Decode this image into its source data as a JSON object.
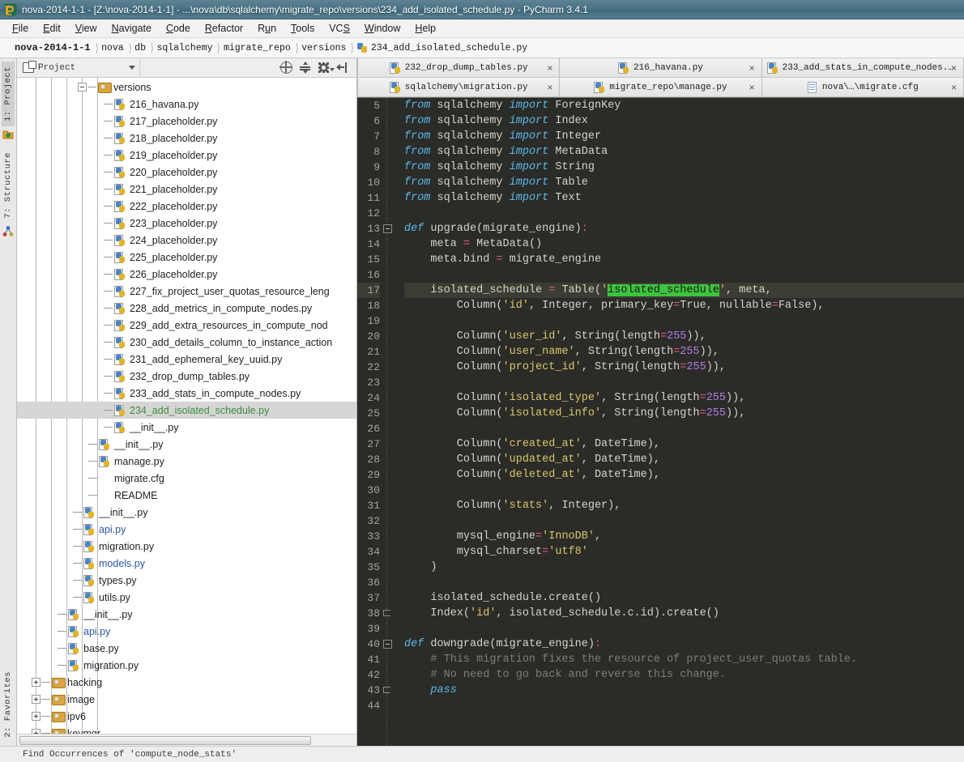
{
  "window": {
    "title": "nova-2014-1-1 - [Z:\\nova-2014-1-1] - ...\\nova\\db\\sqlalchemy\\migrate_repo\\versions\\234_add_isolated_schedule.py - PyCharm 3.4.1",
    "app_icon": "pycharm-icon"
  },
  "menubar": {
    "items": [
      {
        "label": "File",
        "mnemonic": "F"
      },
      {
        "label": "Edit",
        "mnemonic": "E"
      },
      {
        "label": "View",
        "mnemonic": "V"
      },
      {
        "label": "Navigate",
        "mnemonic": "N"
      },
      {
        "label": "Code",
        "mnemonic": "C"
      },
      {
        "label": "Refactor",
        "mnemonic": "R"
      },
      {
        "label": "Run",
        "mnemonic": "n"
      },
      {
        "label": "Tools",
        "mnemonic": "T"
      },
      {
        "label": "VCS",
        "mnemonic": "S"
      },
      {
        "label": "Window",
        "mnemonic": "W"
      },
      {
        "label": "Help",
        "mnemonic": "H"
      }
    ]
  },
  "breadcrumb": {
    "items": [
      "nova-2014-1-1",
      "nova",
      "db",
      "sqlalchemy",
      "migrate_repo",
      "versions"
    ],
    "file": "234_add_isolated_schedule.py"
  },
  "left_tool_strip": {
    "top": [
      {
        "label": "1: Project",
        "selected": true,
        "icon": "project-icon"
      },
      {
        "label": "7: Structure",
        "selected": false,
        "icon": "structure-icon"
      }
    ],
    "bottom": [
      {
        "label": "2: Favorites",
        "selected": false
      }
    ]
  },
  "project_panel": {
    "title": "Project",
    "tools": [
      "scroll-from-source-icon",
      "collapse-all-icon",
      "settings-gear-icon",
      "hide-icon"
    ],
    "tree": [
      {
        "depth": 6,
        "label": "versions",
        "type": "folder",
        "handle": "minus",
        "color": "default"
      },
      {
        "depth": 7,
        "label": "216_havana.py",
        "type": "py",
        "color": "default"
      },
      {
        "depth": 7,
        "label": "217_placeholder.py",
        "type": "py",
        "color": "default"
      },
      {
        "depth": 7,
        "label": "218_placeholder.py",
        "type": "py",
        "color": "default"
      },
      {
        "depth": 7,
        "label": "219_placeholder.py",
        "type": "py",
        "color": "default"
      },
      {
        "depth": 7,
        "label": "220_placeholder.py",
        "type": "py",
        "color": "default"
      },
      {
        "depth": 7,
        "label": "221_placeholder.py",
        "type": "py",
        "color": "default"
      },
      {
        "depth": 7,
        "label": "222_placeholder.py",
        "type": "py",
        "color": "default"
      },
      {
        "depth": 7,
        "label": "223_placeholder.py",
        "type": "py",
        "color": "default"
      },
      {
        "depth": 7,
        "label": "224_placeholder.py",
        "type": "py",
        "color": "default"
      },
      {
        "depth": 7,
        "label": "225_placeholder.py",
        "type": "py",
        "color": "default"
      },
      {
        "depth": 7,
        "label": "226_placeholder.py",
        "type": "py",
        "color": "default"
      },
      {
        "depth": 7,
        "label": "227_fix_project_user_quotas_resource_leng",
        "type": "py",
        "color": "default"
      },
      {
        "depth": 7,
        "label": "228_add_metrics_in_compute_nodes.py",
        "type": "py",
        "color": "default"
      },
      {
        "depth": 7,
        "label": "229_add_extra_resources_in_compute_nod",
        "type": "py",
        "color": "default"
      },
      {
        "depth": 7,
        "label": "230_add_details_column_to_instance_action",
        "type": "py",
        "color": "default"
      },
      {
        "depth": 7,
        "label": "231_add_ephemeral_key_uuid.py",
        "type": "py",
        "color": "default"
      },
      {
        "depth": 7,
        "label": "232_drop_dump_tables.py",
        "type": "py",
        "color": "default"
      },
      {
        "depth": 7,
        "label": "233_add_stats_in_compute_nodes.py",
        "type": "py",
        "color": "default"
      },
      {
        "depth": 7,
        "label": "234_add_isolated_schedule.py",
        "type": "py",
        "color": "green",
        "selected": true
      },
      {
        "depth": 7,
        "label": "__init__.py",
        "type": "py",
        "color": "default",
        "last": true
      },
      {
        "depth": 6,
        "label": "__init__.py",
        "type": "py",
        "color": "default"
      },
      {
        "depth": 6,
        "label": "manage.py",
        "type": "py",
        "color": "default"
      },
      {
        "depth": 6,
        "label": "migrate.cfg",
        "type": "none",
        "color": "default"
      },
      {
        "depth": 6,
        "label": "README",
        "type": "none",
        "color": "default",
        "last": true
      },
      {
        "depth": 5,
        "label": "__init__.py",
        "type": "py",
        "color": "default"
      },
      {
        "depth": 5,
        "label": "api.py",
        "type": "py",
        "color": "blue"
      },
      {
        "depth": 5,
        "label": "migration.py",
        "type": "py",
        "color": "default"
      },
      {
        "depth": 5,
        "label": "models.py",
        "type": "py",
        "color": "blue"
      },
      {
        "depth": 5,
        "label": "types.py",
        "type": "py",
        "color": "default"
      },
      {
        "depth": 5,
        "label": "utils.py",
        "type": "py",
        "color": "default",
        "last": true
      },
      {
        "depth": 4,
        "label": "__init__.py",
        "type": "py",
        "color": "default"
      },
      {
        "depth": 4,
        "label": "api.py",
        "type": "py",
        "color": "blue"
      },
      {
        "depth": 4,
        "label": "base.py",
        "type": "py",
        "color": "default"
      },
      {
        "depth": 4,
        "label": "migration.py",
        "type": "py",
        "color": "default",
        "last": true
      },
      {
        "depth": 3,
        "label": "hacking",
        "type": "folder",
        "handle": "plus",
        "color": "default"
      },
      {
        "depth": 3,
        "label": "image",
        "type": "folder",
        "handle": "plus",
        "color": "default"
      },
      {
        "depth": 3,
        "label": "ipv6",
        "type": "folder",
        "handle": "plus",
        "color": "default"
      },
      {
        "depth": 3,
        "label": "keymgr",
        "type": "folder",
        "handle": "plus",
        "color": "default"
      }
    ]
  },
  "editor_tabs": {
    "row1": [
      {
        "label": "232_drop_dump_tables.py",
        "icon": "py-file-icon",
        "close": "×"
      },
      {
        "label": "216_havana.py",
        "icon": "py-file-icon",
        "close": "×"
      },
      {
        "label": "233_add_stats_in_compute_nodes.py",
        "icon": "py-file-icon",
        "close": "×"
      }
    ],
    "row2": [
      {
        "label": "sqlalchemy\\migration.py",
        "icon": "py-file-icon",
        "close": "×"
      },
      {
        "label": "migrate_repo\\manage.py",
        "icon": "py-file-icon",
        "close": "×"
      },
      {
        "label": "nova\\…\\migrate.cfg",
        "icon": "cfg-file-icon",
        "close": "×"
      }
    ]
  },
  "editor": {
    "first_line_number": 5,
    "current_line": 17,
    "selected_token": "isolated_schedule",
    "colors": {
      "background": "#2b2b28",
      "current_line": "#3c3c33",
      "gutter_text": "#a5a59a",
      "keyword": "#5bb8e8",
      "string": "#d8c76a",
      "number": "#b07de8",
      "operator": "#e0607e",
      "comment": "#7e7e74",
      "identifier": "#d4d4c8",
      "selection_highlight": "#3ec43e"
    },
    "lines": [
      {
        "n": 5,
        "tokens": [
          {
            "t": "from ",
            "c": "kw"
          },
          {
            "t": "sqlalchemy ",
            "c": "id"
          },
          {
            "t": "import ",
            "c": "kw"
          },
          {
            "t": "ForeignKey",
            "c": "id"
          }
        ]
      },
      {
        "n": 6,
        "tokens": [
          {
            "t": "from ",
            "c": "kw"
          },
          {
            "t": "sqlalchemy ",
            "c": "id"
          },
          {
            "t": "import ",
            "c": "kw"
          },
          {
            "t": "Index",
            "c": "id"
          }
        ]
      },
      {
        "n": 7,
        "tokens": [
          {
            "t": "from ",
            "c": "kw"
          },
          {
            "t": "sqlalchemy ",
            "c": "id"
          },
          {
            "t": "import ",
            "c": "kw"
          },
          {
            "t": "Integer",
            "c": "id"
          }
        ]
      },
      {
        "n": 8,
        "tokens": [
          {
            "t": "from ",
            "c": "kw"
          },
          {
            "t": "sqlalchemy ",
            "c": "id"
          },
          {
            "t": "import ",
            "c": "kw"
          },
          {
            "t": "MetaData",
            "c": "id"
          }
        ]
      },
      {
        "n": 9,
        "tokens": [
          {
            "t": "from ",
            "c": "kw"
          },
          {
            "t": "sqlalchemy ",
            "c": "id"
          },
          {
            "t": "import ",
            "c": "kw"
          },
          {
            "t": "String",
            "c": "id"
          }
        ]
      },
      {
        "n": 10,
        "tokens": [
          {
            "t": "from ",
            "c": "kw"
          },
          {
            "t": "sqlalchemy ",
            "c": "id"
          },
          {
            "t": "import ",
            "c": "kw"
          },
          {
            "t": "Table",
            "c": "id"
          }
        ]
      },
      {
        "n": 11,
        "tokens": [
          {
            "t": "from ",
            "c": "kw"
          },
          {
            "t": "sqlalchemy ",
            "c": "id"
          },
          {
            "t": "import ",
            "c": "kw"
          },
          {
            "t": "Text",
            "c": "id"
          }
        ]
      },
      {
        "n": 12,
        "tokens": []
      },
      {
        "n": 13,
        "fold": "start",
        "tokens": [
          {
            "t": "def ",
            "c": "kw"
          },
          {
            "t": "upgrade",
            "c": "id"
          },
          {
            "t": "(",
            "c": "punc"
          },
          {
            "t": "migrate_engine",
            "c": "id"
          },
          {
            "t": ")",
            "c": "punc"
          },
          {
            "t": ":",
            "c": "op"
          }
        ]
      },
      {
        "n": 14,
        "tokens": [
          {
            "t": "    meta ",
            "c": "id"
          },
          {
            "t": "=",
            "c": "op"
          },
          {
            "t": " MetaData()",
            "c": "id"
          }
        ]
      },
      {
        "n": 15,
        "tokens": [
          {
            "t": "    meta.bind ",
            "c": "id"
          },
          {
            "t": "=",
            "c": "op"
          },
          {
            "t": " migrate_engine",
            "c": "id"
          }
        ]
      },
      {
        "n": 16,
        "tokens": []
      },
      {
        "n": 17,
        "current": true,
        "tokens": [
          {
            "t": "    isolated_schedule ",
            "c": "id"
          },
          {
            "t": "=",
            "c": "op"
          },
          {
            "t": " Table(",
            "c": "id"
          },
          {
            "t": "'",
            "c": "str"
          },
          {
            "t": "isolated_schedule",
            "c": "sel-hl"
          },
          {
            "t": "'",
            "c": "str"
          },
          {
            "t": ", meta,",
            "c": "id"
          }
        ]
      },
      {
        "n": 18,
        "tokens": [
          {
            "t": "        Column(",
            "c": "id"
          },
          {
            "t": "'id'",
            "c": "str"
          },
          {
            "t": ", Integer, primary_key",
            "c": "id"
          },
          {
            "t": "=",
            "c": "op"
          },
          {
            "t": "True, nullable",
            "c": "id"
          },
          {
            "t": "=",
            "c": "op"
          },
          {
            "t": "False),",
            "c": "id"
          }
        ]
      },
      {
        "n": 19,
        "tokens": []
      },
      {
        "n": 20,
        "tokens": [
          {
            "t": "        Column(",
            "c": "id"
          },
          {
            "t": "'user_id'",
            "c": "str"
          },
          {
            "t": ", String(length",
            "c": "id"
          },
          {
            "t": "=",
            "c": "op"
          },
          {
            "t": "255",
            "c": "num"
          },
          {
            "t": ")),",
            "c": "id"
          }
        ]
      },
      {
        "n": 21,
        "tokens": [
          {
            "t": "        Column(",
            "c": "id"
          },
          {
            "t": "'user_name'",
            "c": "str"
          },
          {
            "t": ", String(length",
            "c": "id"
          },
          {
            "t": "=",
            "c": "op"
          },
          {
            "t": "255",
            "c": "num"
          },
          {
            "t": ")),",
            "c": "id"
          }
        ]
      },
      {
        "n": 22,
        "tokens": [
          {
            "t": "        Column(",
            "c": "id"
          },
          {
            "t": "'project_id'",
            "c": "str"
          },
          {
            "t": ", String(length",
            "c": "id"
          },
          {
            "t": "=",
            "c": "op"
          },
          {
            "t": "255",
            "c": "num"
          },
          {
            "t": ")),",
            "c": "id"
          }
        ]
      },
      {
        "n": 23,
        "tokens": []
      },
      {
        "n": 24,
        "tokens": [
          {
            "t": "        Column(",
            "c": "id"
          },
          {
            "t": "'isolated_type'",
            "c": "str"
          },
          {
            "t": ", String(length",
            "c": "id"
          },
          {
            "t": "=",
            "c": "op"
          },
          {
            "t": "255",
            "c": "num"
          },
          {
            "t": ")),",
            "c": "id"
          }
        ]
      },
      {
        "n": 25,
        "tokens": [
          {
            "t": "        Column(",
            "c": "id"
          },
          {
            "t": "'isolated_info'",
            "c": "str"
          },
          {
            "t": ", String(length",
            "c": "id"
          },
          {
            "t": "=",
            "c": "op"
          },
          {
            "t": "255",
            "c": "num"
          },
          {
            "t": ")),",
            "c": "id"
          }
        ]
      },
      {
        "n": 26,
        "tokens": []
      },
      {
        "n": 27,
        "tokens": [
          {
            "t": "        Column(",
            "c": "id"
          },
          {
            "t": "'created_at'",
            "c": "str"
          },
          {
            "t": ", DateTime),",
            "c": "id"
          }
        ]
      },
      {
        "n": 28,
        "tokens": [
          {
            "t": "        Column(",
            "c": "id"
          },
          {
            "t": "'updated_at'",
            "c": "str"
          },
          {
            "t": ", DateTime),",
            "c": "id"
          }
        ]
      },
      {
        "n": 29,
        "tokens": [
          {
            "t": "        Column(",
            "c": "id"
          },
          {
            "t": "'deleted_at'",
            "c": "str"
          },
          {
            "t": ", DateTime),",
            "c": "id"
          }
        ]
      },
      {
        "n": 30,
        "tokens": []
      },
      {
        "n": 31,
        "tokens": [
          {
            "t": "        Column(",
            "c": "id"
          },
          {
            "t": "'stats'",
            "c": "str"
          },
          {
            "t": ", Integer),",
            "c": "id"
          }
        ]
      },
      {
        "n": 32,
        "tokens": []
      },
      {
        "n": 33,
        "tokens": [
          {
            "t": "        mysql_engine",
            "c": "id"
          },
          {
            "t": "=",
            "c": "op"
          },
          {
            "t": "'InnoDB'",
            "c": "str"
          },
          {
            "t": ",",
            "c": "id"
          }
        ]
      },
      {
        "n": 34,
        "tokens": [
          {
            "t": "        mysql_charset",
            "c": "id"
          },
          {
            "t": "=",
            "c": "op"
          },
          {
            "t": "'utf8'",
            "c": "str"
          }
        ]
      },
      {
        "n": 35,
        "tokens": [
          {
            "t": "    )",
            "c": "id"
          }
        ]
      },
      {
        "n": 36,
        "tokens": []
      },
      {
        "n": 37,
        "tokens": [
          {
            "t": "    isolated_schedule.create()",
            "c": "id"
          }
        ]
      },
      {
        "n": 38,
        "fold": "end",
        "tokens": [
          {
            "t": "    Index(",
            "c": "id"
          },
          {
            "t": "'id'",
            "c": "str"
          },
          {
            "t": ", isolated_schedule.c.id).create()",
            "c": "id"
          }
        ]
      },
      {
        "n": 39,
        "tokens": []
      },
      {
        "n": 40,
        "fold": "start",
        "tokens": [
          {
            "t": "def ",
            "c": "kw"
          },
          {
            "t": "downgrade",
            "c": "id"
          },
          {
            "t": "(",
            "c": "punc"
          },
          {
            "t": "migrate_engine",
            "c": "id"
          },
          {
            "t": ")",
            "c": "punc"
          },
          {
            "t": ":",
            "c": "op"
          }
        ]
      },
      {
        "n": 41,
        "tokens": [
          {
            "t": "    # This migration fixes the resource of project_user_quotas table.",
            "c": "cmt"
          }
        ]
      },
      {
        "n": 42,
        "tokens": [
          {
            "t": "    # No need to go back and reverse this change.",
            "c": "cmt"
          }
        ]
      },
      {
        "n": 43,
        "fold": "end",
        "tokens": [
          {
            "t": "    pass",
            "c": "kw"
          }
        ]
      },
      {
        "n": 44,
        "tokens": []
      }
    ]
  },
  "statusbar": {
    "text": "Find  Occurrences of 'compute_node_stats'"
  }
}
